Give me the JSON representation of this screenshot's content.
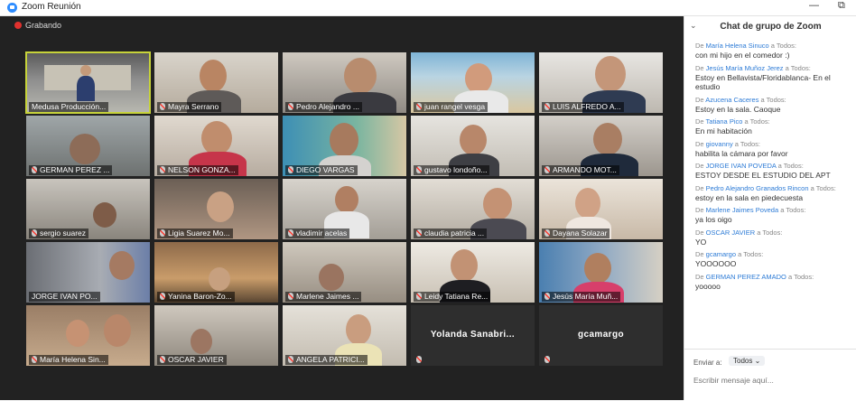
{
  "window": {
    "title": "Zoom Reunión",
    "minimize_label": "—",
    "restore_label": "⧉"
  },
  "recording": {
    "label": "Grabando"
  },
  "participants": [
    "Medusa Producción...",
    "Mayra Serrano",
    "Pedro Alejandro ...",
    "juan rangel vesga",
    "LUIS ALFREDO A...",
    "GERMAN PEREZ ...",
    "NELSON GONZA...",
    "DIEGO VARGAS",
    "gustavo londoño...",
    "ARMANDO MOT...",
    "sergio suarez",
    "Ligia Suarez Mo...",
    "vladimir acelas",
    "claudia patricia ...",
    "Dayana Solazar",
    "JORGE IVAN PO...",
    "Yanina Baron-Zo...",
    "Marlene Jaimes ...",
    "Leidy Tatiana Re...",
    "Jesús María Muñ...",
    "María Helena Sin...",
    "OSCAR JAVIER",
    "ANGELA PATRICI...",
    "Yolanda Sanabri...",
    "gcamargo"
  ],
  "chat": {
    "title": "Chat de grupo de Zoom",
    "messages": [
      {
        "prefix": "De ",
        "sender": "María Helena Sinuco",
        "suffix": " a Todos:",
        "text": "con mi hijo en el comedor :)"
      },
      {
        "prefix": "De ",
        "sender": "Jesús María Muñoz Jerez",
        "suffix": " a Todos:",
        "text": "Estoy en Bellavista/Floridablanca- En el estudio"
      },
      {
        "prefix": "De ",
        "sender": "Azucena Caceres",
        "suffix": " a Todos:",
        "text": "Estoy en la sala. Caoque"
      },
      {
        "prefix": "De ",
        "sender": "Tatiana Pico",
        "suffix": " a Todos:",
        "text": "En mi habitación"
      },
      {
        "prefix": "De ",
        "sender": "giovanny",
        "suffix": " a Todos:",
        "text": "habilita la cámara por favor"
      },
      {
        "prefix": "De ",
        "sender": "JORGE IVAN POVEDA",
        "suffix": " a Todos:",
        "text": "ESTOY DESDE EL ESTUDIO DEL APT"
      },
      {
        "prefix": "De ",
        "sender": "Pedro Alejandro Granados Rincon",
        "suffix": " a Todos:",
        "text": "estoy en la sala en piedecuesta"
      },
      {
        "prefix": "De ",
        "sender": "Marlene Jaimes Poveda",
        "suffix": " a Todos:",
        "text": "ya los oigo"
      },
      {
        "prefix": "De ",
        "sender": "OSCAR JAVIER",
        "suffix": " a Todos:",
        "text": "YO"
      },
      {
        "prefix": "De ",
        "sender": "gcamargo",
        "suffix": " a Todos:",
        "text": "YOOOOOO"
      },
      {
        "prefix": "De ",
        "sender": "GERMAN PEREZ AMADO",
        "suffix": " a Todos:",
        "text": "yooooo"
      }
    ],
    "send_label": "Enviar a:",
    "send_to": "Todos ⌄",
    "placeholder": "Escribir mensaje aquí..."
  },
  "colors": {
    "accent": "#2d8cff",
    "stage_bg": "#222222",
    "active_speaker": "#c7d33a",
    "recording": "#e0312e",
    "sender_link": "#2d7bd6"
  }
}
